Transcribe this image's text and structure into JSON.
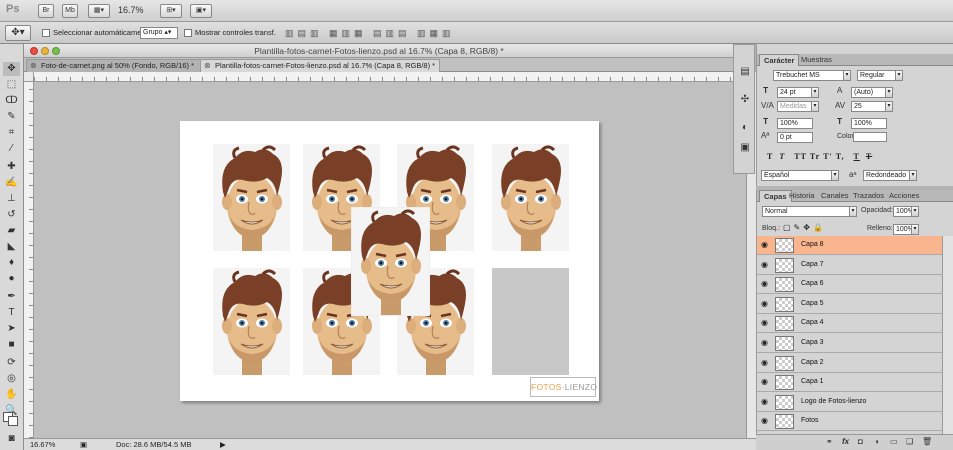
{
  "app": {
    "logo": "Ps",
    "zoom": "16.7%",
    "buttons": [
      "Br",
      "Mb"
    ]
  },
  "options": {
    "auto_select_label": "Seleccionar automáticamente:",
    "auto_select_value": "Grupo",
    "transform_label": "Mostrar controles transf."
  },
  "document": {
    "window_title": "Plantilla-fotos-carnet-Fotos-lienzo.psd al 16.7% (Capa 8, RGB/8) *",
    "tabs": [
      {
        "label": "Foto-de-carnet.png al 50% (Fondo, RGB/16) *",
        "active": false
      },
      {
        "label": "Plantilla-fotos-carnet-Fotos-lienzo.psd al 16.7% (Capa 8, RGB/8) *",
        "active": true
      }
    ],
    "canvas_logo_part1": "FOTOS",
    "canvas_logo_part2": "LIENZO"
  },
  "status": {
    "zoom": "16.67%",
    "doc": "Doc: 28.6 MB/54.5 MB"
  },
  "character": {
    "tabs": [
      "Carácter",
      "Muestras"
    ],
    "font_family": "Trebuchet MS",
    "font_style": "Regular",
    "font_size": "24 pt",
    "leading": "(Auto)",
    "kerning": "Medidas",
    "tracking": "25",
    "vscale": "100%",
    "hscale": "100%",
    "baseline": "0 pt",
    "color_label": "Color:",
    "language": "Español",
    "antialias_symbol": "aᵃ",
    "antialias": "Redondeado",
    "style_buttons": [
      "T",
      "T",
      "TT",
      "Tr",
      "T'",
      "T,",
      "T",
      "T"
    ]
  },
  "layers": {
    "tabs": [
      "Capas",
      "Historia",
      "Canales",
      "Trazados",
      "Acciones"
    ],
    "blend_mode": "Normal",
    "opacity_label": "Opacidad:",
    "opacity": "100%",
    "lock_label": "Bloq.:",
    "fill_label": "Relleno:",
    "fill": "100%",
    "items": [
      {
        "name": "Capa 8",
        "selected": true
      },
      {
        "name": "Capa 7",
        "selected": false
      },
      {
        "name": "Capa 6",
        "selected": false
      },
      {
        "name": "Capa 5",
        "selected": false
      },
      {
        "name": "Capa 4",
        "selected": false
      },
      {
        "name": "Capa 3",
        "selected": false
      },
      {
        "name": "Capa 2",
        "selected": false
      },
      {
        "name": "Capa 1",
        "selected": false
      },
      {
        "name": "Logo de Fotos-lienzo",
        "selected": false
      },
      {
        "name": "Fotos",
        "selected": false
      }
    ],
    "footer_icons": [
      "link-icon",
      "fx-icon",
      "mask-icon",
      "adjustment-icon",
      "folder-icon",
      "new-layer-icon",
      "trash-icon"
    ]
  },
  "colors": {
    "selected_layer": "#f9b68e",
    "hair": "#7a4027",
    "skin": "#e7bc8b",
    "logo_orange": "#e8a14a"
  }
}
